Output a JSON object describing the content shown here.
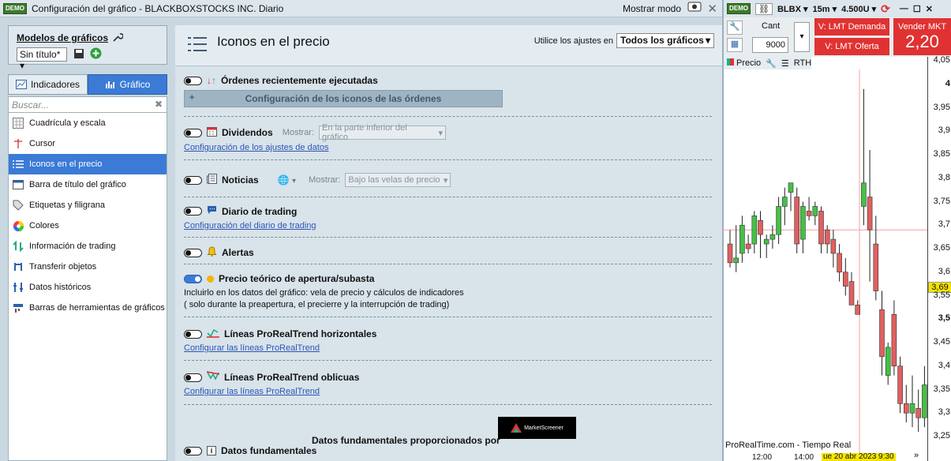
{
  "title_bar": {
    "badge": "DEMO",
    "title": "Configuración del gráfico - BLACKBOXSTOCKS INC. Diario",
    "mode_label": "Mostrar modo"
  },
  "left": {
    "models_title": "Modelos de gráficos",
    "model_select": "Sin título*",
    "tabs": [
      "Indicadores",
      "Gráfico"
    ],
    "search_placeholder": "Buscar...",
    "items": [
      "Cuadrícula y escala",
      "Cursor",
      "Iconos en el precio",
      "Barra de título del gráfico",
      "Etiquetas y filigrana",
      "Colores",
      "Información de trading",
      "Transferir objetos",
      "Datos históricos",
      "Barras de herramientas de gráficos"
    ]
  },
  "main": {
    "heading": "Iconos en el precio",
    "apply_label": "Utilice los ajustes en",
    "apply_select": "Todos los gráficos",
    "orders_label": "Órdenes recientemente ejecutadas",
    "orders_config": "Configuración de los iconos de las órdenes",
    "dividends_label": "Dividendos",
    "show_label": "Mostrar:",
    "dividends_select": "En la parte inferior del gráfico",
    "data_config_link": "Configuración de los ajustes de datos",
    "news_label": "Noticias",
    "news_select": "Bajo las velas de precio",
    "journal_label": "Diario de trading",
    "journal_link": "Configuración del diario de trading",
    "alerts_label": "Alertas",
    "theo_label": "Precio teórico de apertura/subasta",
    "theo_note1": "Incluirlo en los datos del gráfico: vela de precio y cálculos de indicadores",
    "theo_note2": "( solo durante la preapertura, el precierre y la interrupción de trading)",
    "prt_h_label": "Líneas ProRealTrend horizontales",
    "prt_o_label": "Líneas ProRealTrend oblicuas",
    "prt_link": "Configurar las líneas ProRealTrend",
    "fund_note": "Datos fundamentales proporcionados por",
    "fund_logo": "MarketScreener",
    "fund_label": "Datos fundamentales"
  },
  "right": {
    "badge": "DEMO",
    "symbol": "BLBX",
    "interval": "15m",
    "units": "4.500U",
    "qty_label": "Cant",
    "qty_value": "9000",
    "buy1": "V: LMT Demanda",
    "buy2": "V: LMT Oferta",
    "sell_label": "Vender MKT",
    "sell_value": "2,20",
    "tab_price": "Precio",
    "tab_rth": "RTH",
    "footer": "ProRealTime.com - Tiempo Real",
    "x_labels": [
      "12:00",
      "14:00"
    ],
    "x_date": "ue 20 abr 2023 9:30",
    "last_price": "3,69",
    "colors": {
      "up": "#46c046",
      "down": "#e06060",
      "sell": "#e03232"
    }
  },
  "chart_data": {
    "type": "candlestick",
    "y_ticks": [
      "4,05",
      "4",
      "3,95",
      "3,9",
      "3,85",
      "3,8",
      "3,75",
      "3,7",
      "3,65",
      "3,6",
      "3,55",
      "3,5",
      "3,45",
      "3,4",
      "3,35",
      "3,3",
      "3,25"
    ],
    "y_range": [
      3.23,
      4.06
    ],
    "candles": [
      {
        "o": 3.66,
        "h": 3.69,
        "l": 3.61,
        "c": 3.62
      },
      {
        "o": 3.62,
        "h": 3.7,
        "l": 3.6,
        "c": 3.63
      },
      {
        "o": 3.64,
        "h": 3.72,
        "l": 3.62,
        "c": 3.7
      },
      {
        "o": 3.66,
        "h": 3.68,
        "l": 3.64,
        "c": 3.65
      },
      {
        "o": 3.66,
        "h": 3.73,
        "l": 3.64,
        "c": 3.72
      },
      {
        "o": 3.71,
        "h": 3.73,
        "l": 3.63,
        "c": 3.68
      },
      {
        "o": 3.66,
        "h": 3.68,
        "l": 3.63,
        "c": 3.67
      },
      {
        "o": 3.67,
        "h": 3.7,
        "l": 3.65,
        "c": 3.68
      },
      {
        "o": 3.68,
        "h": 3.76,
        "l": 3.66,
        "c": 3.74
      },
      {
        "o": 3.74,
        "h": 3.78,
        "l": 3.7,
        "c": 3.76
      },
      {
        "o": 3.77,
        "h": 3.79,
        "l": 3.73,
        "c": 3.79
      },
      {
        "o": 3.76,
        "h": 3.78,
        "l": 3.64,
        "c": 3.66
      },
      {
        "o": 3.67,
        "h": 3.75,
        "l": 3.64,
        "c": 3.74
      },
      {
        "o": 3.73,
        "h": 3.76,
        "l": 3.71,
        "c": 3.72
      },
      {
        "o": 3.72,
        "h": 3.75,
        "l": 3.7,
        "c": 3.74
      },
      {
        "o": 3.73,
        "h": 3.74,
        "l": 3.64,
        "c": 3.66
      },
      {
        "o": 3.69,
        "h": 3.7,
        "l": 3.64,
        "c": 3.66
      },
      {
        "o": 3.67,
        "h": 3.69,
        "l": 3.61,
        "c": 3.64
      },
      {
        "o": 3.64,
        "h": 3.66,
        "l": 3.58,
        "c": 3.6
      },
      {
        "o": 3.6,
        "h": 3.63,
        "l": 3.55,
        "c": 3.57
      },
      {
        "o": 3.58,
        "h": 3.6,
        "l": 3.53,
        "c": 3.53
      },
      {
        "o": 3.53,
        "h": 3.54,
        "l": 3.51,
        "c": 3.51
      },
      {
        "o": 3.74,
        "h": 3.99,
        "l": 3.7,
        "c": 3.79
      },
      {
        "o": 3.76,
        "h": 3.86,
        "l": 3.58,
        "c": 3.69
      },
      {
        "o": 3.66,
        "h": 3.72,
        "l": 3.54,
        "c": 3.56
      },
      {
        "o": 3.52,
        "h": 3.56,
        "l": 3.38,
        "c": 3.42
      },
      {
        "o": 3.38,
        "h": 3.45,
        "l": 3.36,
        "c": 3.44
      },
      {
        "o": 3.51,
        "h": 3.54,
        "l": 3.38,
        "c": 3.4
      },
      {
        "o": 3.4,
        "h": 3.42,
        "l": 3.3,
        "c": 3.32
      },
      {
        "o": 3.32,
        "h": 3.36,
        "l": 3.28,
        "c": 3.3
      },
      {
        "o": 3.3,
        "h": 3.38,
        "l": 3.27,
        "c": 3.32
      },
      {
        "o": 3.31,
        "h": 3.35,
        "l": 3.26,
        "c": 3.29
      },
      {
        "o": 3.29,
        "h": 3.4,
        "l": 3.27,
        "c": 3.36
      }
    ]
  }
}
